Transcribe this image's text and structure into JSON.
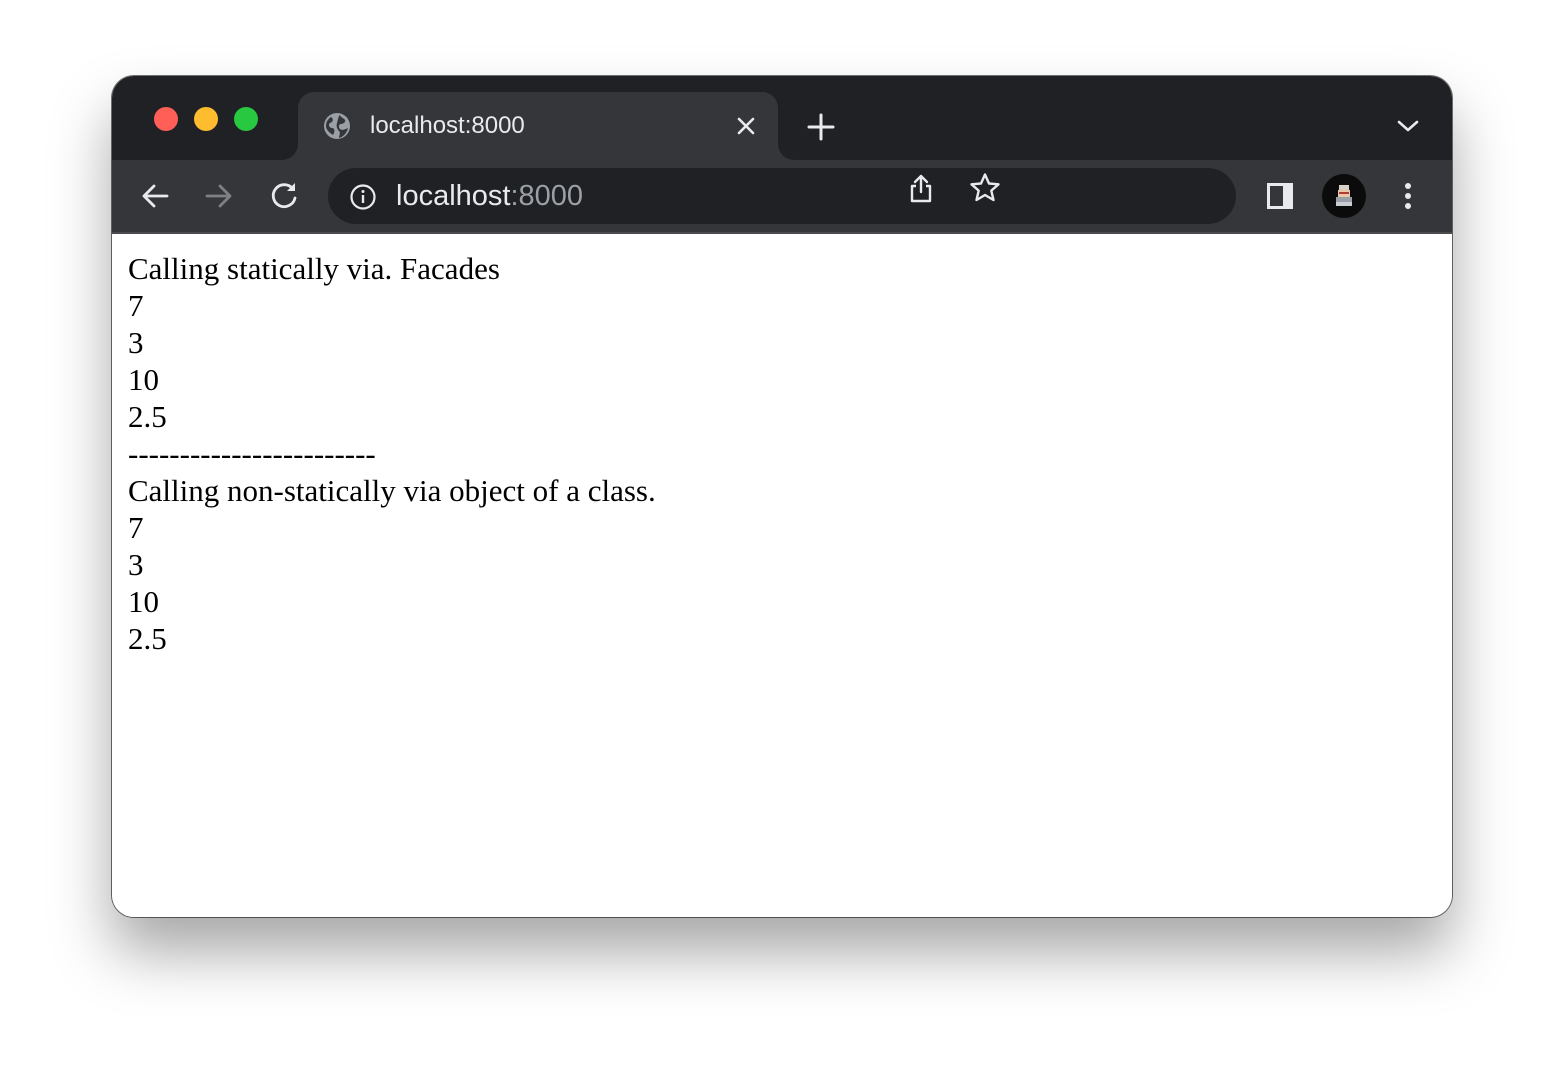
{
  "browser": {
    "tab": {
      "title": "localhost:8000",
      "favicon": "globe-icon"
    },
    "address_bar": {
      "host": "localhost",
      "port": ":8000",
      "security_icon": "info-icon"
    },
    "colors": {
      "frame": "#202124",
      "toolbar": "#35363a",
      "close_red": "#ff5f57",
      "minimize_yellow": "#febc2e",
      "zoom_green": "#28c840"
    },
    "icons": [
      "back-arrow-icon",
      "forward-arrow-icon",
      "reload-icon",
      "share-icon",
      "star-icon",
      "side-panel-icon",
      "profile-avatar",
      "more-menu-icon",
      "new-tab-icon",
      "tab-list-chevron-icon"
    ]
  },
  "page": {
    "lines": [
      "Calling statically via. Facades",
      "7",
      "3",
      "10",
      "2.5",
      "------------------------",
      "Calling non-statically via object of a class.",
      "7",
      "3",
      "10",
      "2.5"
    ]
  }
}
